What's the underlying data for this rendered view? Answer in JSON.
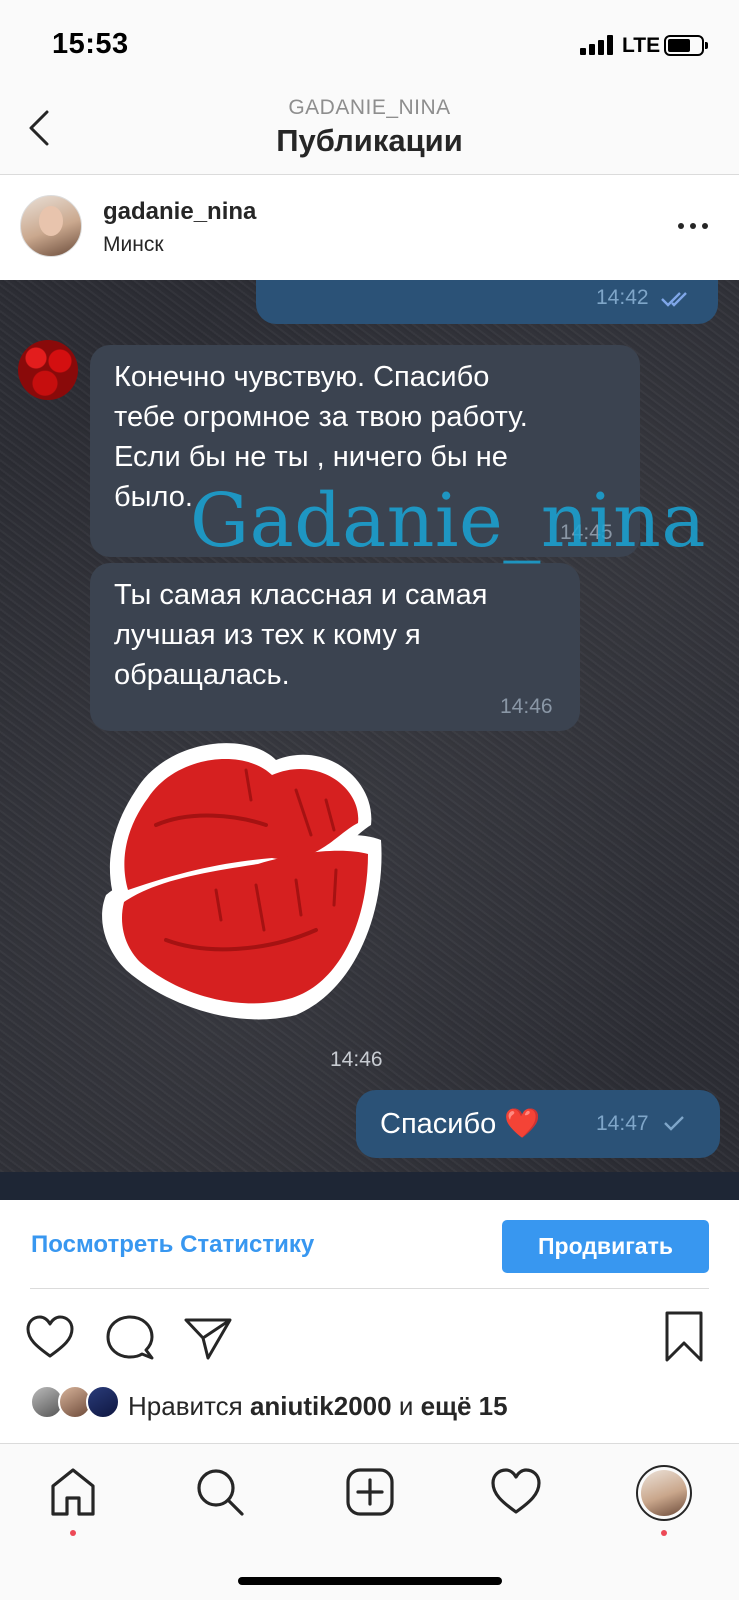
{
  "status_bar": {
    "time": "15:53",
    "network": "LTE"
  },
  "header": {
    "subtitle": "GADANIE_NINA",
    "title": "Публикации"
  },
  "post": {
    "username": "gadanie_nina",
    "location": "Минск",
    "image": {
      "watermark": "Gadanie_nina",
      "messages": [
        {
          "direction": "out",
          "text": "",
          "time": "14:42",
          "status_icon": "double-check-icon"
        },
        {
          "direction": "in",
          "lines": [
            "Конечно чувствую. Спасибо",
            "тебе огромное за твою работу.",
            "Если бы не ты , ничего бы не",
            "было."
          ],
          "time": "14:45"
        },
        {
          "direction": "in",
          "lines": [
            "Ты самая классная и самая",
            "лучшая из тех к кому я",
            "обращалась."
          ],
          "time": "14:46"
        },
        {
          "direction": "in",
          "type": "sticker",
          "sticker": "lips-sticker",
          "time": "14:46"
        },
        {
          "direction": "out",
          "text": "Спасибо ❤️",
          "time": "14:47",
          "status_icon": "check-icon"
        }
      ]
    },
    "stats_link": "Посмотреть Статистику",
    "promote_button": "Продвигать",
    "likes": {
      "prefix": "Нравится ",
      "user": "aniutik2000",
      "middle": " и ",
      "rest": "ещё 15"
    }
  },
  "tabbar": {
    "items": [
      "home-icon",
      "search-icon",
      "new-post-icon",
      "activity-icon",
      "profile-avatar"
    ]
  },
  "colors": {
    "accent": "#3897f0",
    "notification": "#ed4956",
    "bubble_in": "#3b4350",
    "bubble_out": "#2b5277",
    "watermark": "#1aa5d6",
    "lips": "#d62020"
  }
}
